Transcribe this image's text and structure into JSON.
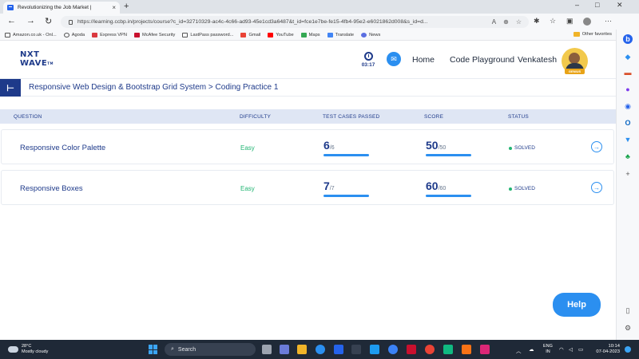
{
  "browser": {
    "tab_title": "Revolutionizing the Job Market |",
    "url": "https://learning.ccbp.in/projects/course?c_id=32710329-ac4c-4c66-ad93-45e1cd3a6487&t_id=fce1e7be-fe15-4fb4-95e2-e6021862d008&s_id=d...",
    "bookmarks": [
      "Amazon.co.uk - Onl...",
      "Agoda",
      "Express VPN",
      "McAfee Security",
      "LastPass password...",
      "Gmail",
      "YouTube",
      "Maps",
      "Translate",
      "News"
    ],
    "other_favorites": "Other favorites"
  },
  "header": {
    "logo_line1": "NXT",
    "logo_line2": "WAVE",
    "timer": "03:17",
    "nav_home": "Home",
    "nav_playground": "Code Playground",
    "user_name": "Venkatesh",
    "badge": "GENIUS"
  },
  "breadcrumb": "Responsive Web Design & Bootstrap Grid System > Coding Practice 1",
  "table": {
    "headers": {
      "question": "QUESTION",
      "difficulty": "DIFFICULTY",
      "tests": "TEST CASES PASSED",
      "score": "SCORE",
      "status": "STATUS"
    },
    "rows": [
      {
        "question": "Responsive Color Palette",
        "difficulty": "Easy",
        "tests_passed": "6",
        "tests_total": "/6",
        "score": "50",
        "score_total": "/50",
        "status": "SOLVED"
      },
      {
        "question": "Responsive Boxes",
        "difficulty": "Easy",
        "tests_passed": "7",
        "tests_total": "/7",
        "score": "60",
        "score_total": "/60",
        "status": "SOLVED"
      }
    ]
  },
  "help_label": "Help",
  "taskbar": {
    "temp": "28°C",
    "weather": "Mostly cloudy",
    "search": "Search",
    "lang1": "ENG",
    "lang2": "IN",
    "time": "10:14",
    "date": "07-04-2023"
  },
  "colors": {
    "brand": "#1e3a8a",
    "accent": "#2b8ff0",
    "success": "#22b573",
    "header_band": "#dfe6f4"
  }
}
